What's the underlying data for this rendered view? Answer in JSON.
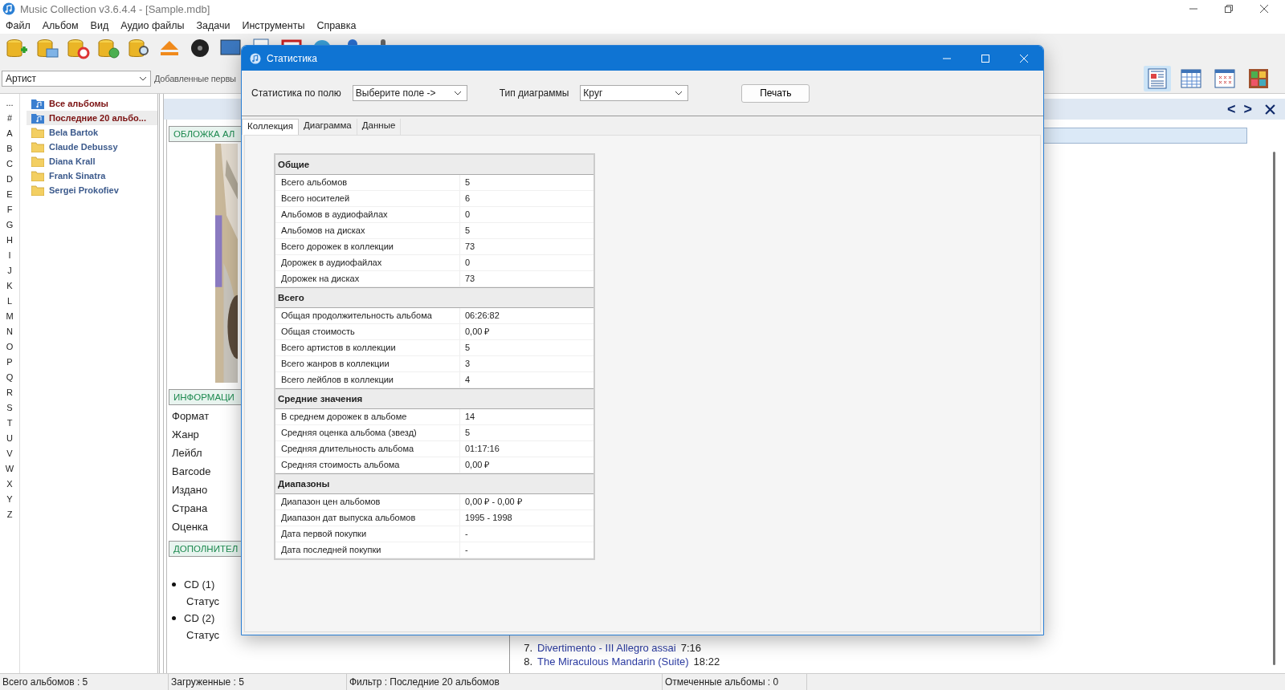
{
  "window": {
    "title": "Music Collection v3.6.4.4 - [Sample.mdb]"
  },
  "menu": [
    "Файл",
    "Альбом",
    "Вид",
    "Аудио файлы",
    "Задачи",
    "Инструменты",
    "Справка"
  ],
  "filter": {
    "field": "Артист",
    "label": "Добавленные первы"
  },
  "view_buttons": [
    {
      "kind": "details",
      "selected": true
    },
    {
      "kind": "table",
      "selected": false
    },
    {
      "kind": "grid",
      "selected": false
    },
    {
      "kind": "tiles",
      "selected": false
    }
  ],
  "alphabet": [
    "...",
    "#",
    "A",
    "B",
    "C",
    "D",
    "E",
    "F",
    "G",
    "H",
    "I",
    "J",
    "K",
    "L",
    "M",
    "N",
    "O",
    "P",
    "Q",
    "R",
    "S",
    "T",
    "U",
    "V",
    "W",
    "X",
    "Y",
    "Z"
  ],
  "tree": [
    {
      "label": "Все альбомы",
      "kind": "special",
      "selected": false
    },
    {
      "label": "Последние 20 альбо...",
      "kind": "special",
      "selected": true
    },
    {
      "label": "Bela Bartok",
      "kind": "folder",
      "selected": false
    },
    {
      "label": "Claude Debussy",
      "kind": "folder",
      "selected": false
    },
    {
      "label": "Diana Krall",
      "kind": "folder",
      "selected": false
    },
    {
      "label": "Frank Sinatra",
      "kind": "folder",
      "selected": false
    },
    {
      "label": "Sergei Prokofiev",
      "kind": "folder",
      "selected": false
    }
  ],
  "album_panel": {
    "cover_header": "ОБЛОЖКА АЛ",
    "info_header": "ИНФОРМАЦИ",
    "info_labels": [
      "Формат",
      "Жанр",
      "Лейбл",
      "Barcode",
      "Издано",
      "Страна",
      "Оценка"
    ],
    "extra_header": "ДОПОЛНИТЕЛ",
    "media": [
      {
        "name": "CD (1)",
        "status": "Статус"
      },
      {
        "name": "CD (2)",
        "status": "Статус"
      }
    ]
  },
  "nav": {
    "previous": "<",
    "next": ">"
  },
  "tracks": [
    {
      "number": "7.",
      "title": "Divertimento - III Allegro assai",
      "duration": "7:16"
    },
    {
      "number": "8.",
      "title": "The Miraculous Mandarin (Suite)",
      "duration": "18:22"
    }
  ],
  "status_bar": [
    "Всего альбомов : 5",
    "Загруженные : 5",
    "Фильтр : Последние 20 альбомов",
    "Отмеченные альбомы : 0"
  ],
  "dialog": {
    "title": "Статистика",
    "field_label": "Статистика по полю",
    "field_value": "Выберите поле ->",
    "chart_label": "Тип диаграммы",
    "chart_value": "Круг",
    "print": "Печать",
    "tabs": [
      {
        "label": "Коллекция",
        "selected": true
      },
      {
        "label": "Диаграмма",
        "selected": false
      },
      {
        "label": "Данные",
        "selected": false
      }
    ],
    "sections": [
      {
        "title": "Общие",
        "rows": [
          [
            "Всего альбомов",
            "5"
          ],
          [
            "Всего носителей",
            "6"
          ],
          [
            "Альбомов в аудиофайлах",
            "0"
          ],
          [
            "Альбомов на дисках",
            "5"
          ],
          [
            "Всего дорожек в коллекции",
            "73"
          ],
          [
            "Дорожек в аудиофайлах",
            "0"
          ],
          [
            "Дорожек на дисках",
            "73"
          ]
        ]
      },
      {
        "title": "Всего",
        "rows": [
          [
            "Общая продолжительность альбома",
            "06:26:82"
          ],
          [
            "Общая стоимость",
            "0,00 ₽"
          ],
          [
            "Всего артистов в коллекции",
            "5"
          ],
          [
            "Всего жанров в коллекции",
            "3"
          ],
          [
            "Всего лейблов в коллекции",
            "4"
          ]
        ]
      },
      {
        "title": "Средние значения",
        "rows": [
          [
            "В среднем дорожек в альбоме",
            "14"
          ],
          [
            "Средняя оценка альбома (звезд)",
            "5"
          ],
          [
            "Средняя длительность альбома",
            "01:17:16"
          ],
          [
            "Средняя стоимость альбома",
            "0,00 ₽"
          ]
        ]
      },
      {
        "title": "Диапазоны",
        "rows": [
          [
            "Диапазон цен альбомов",
            "0,00 ₽  -  0,00 ₽"
          ],
          [
            "Диапазон дат выпуска альбомов",
            "1995  -  1998"
          ],
          [
            "Дата первой покупки",
            "-"
          ],
          [
            "Дата последней покупки",
            "-"
          ]
        ]
      }
    ]
  }
}
